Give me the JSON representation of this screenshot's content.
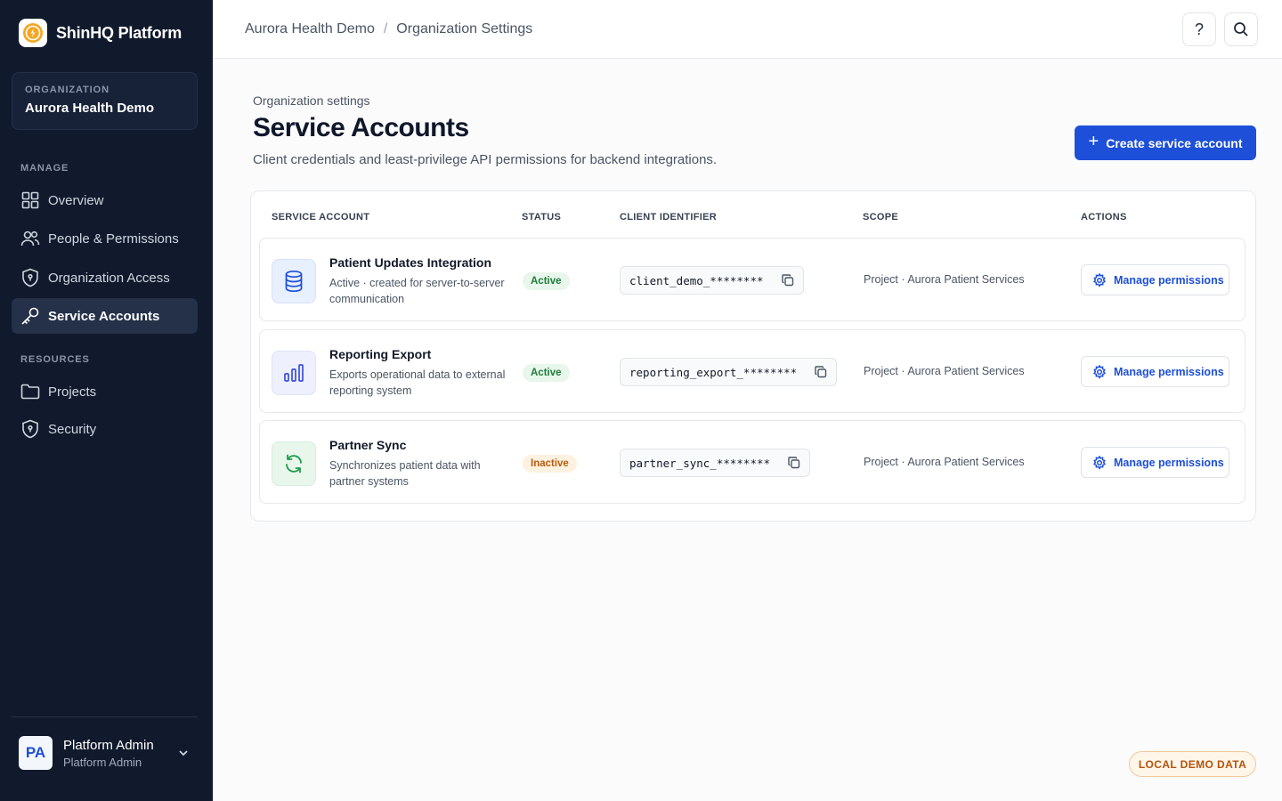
{
  "brand": {
    "name": "ShinHQ Platform",
    "logo_icon": "bolt-icon"
  },
  "organization": {
    "label": "ORGANIZATION",
    "name": "Aurora Health Demo"
  },
  "sidebar": {
    "manage_label": "MANAGE",
    "manage_items": [
      {
        "label": "Overview",
        "icon": "grid-icon"
      },
      {
        "label": "People & Permissions",
        "icon": "users-icon"
      },
      {
        "label": "Organization Access",
        "icon": "shield-icon"
      },
      {
        "label": "Service Accounts",
        "icon": "key-icon",
        "active": true
      }
    ],
    "resources_label": "RESOURCES",
    "resource_items": [
      {
        "label": "Projects",
        "icon": "folder-icon"
      },
      {
        "label": "Security",
        "icon": "shield-icon"
      }
    ]
  },
  "user": {
    "initials": "PA",
    "name": "Platform Admin",
    "role": "Platform Admin"
  },
  "topbar": {
    "breadcrumb": [
      "Aurora Health Demo",
      "Organization Settings"
    ],
    "separator": "/",
    "help_label": "?",
    "search_icon": "search-icon"
  },
  "page": {
    "kicker": "Organization settings",
    "title": "Service Accounts",
    "description": "Client credentials and least-privilege API permissions for backend integrations.",
    "create_plus": "+",
    "create_label": "Create service account"
  },
  "table": {
    "headers": [
      "SERVICE ACCOUNT",
      "STATUS",
      "CLIENT IDENTIFIER",
      "SCOPE",
      "ACTIONS"
    ],
    "rows": [
      {
        "name": "Patient Updates Integration",
        "description": "Active · created for server-to-server communication",
        "status": "Active",
        "client_id": "client_demo_********",
        "scope": "Project · Aurora Patient Services",
        "action": "Manage permissions",
        "icon": "database-icon"
      },
      {
        "name": "Reporting Export",
        "description": "Exports operational data to external reporting system",
        "status": "Active",
        "client_id": "reporting_export_********",
        "scope": "Project · Aurora Patient Services",
        "action": "Manage permissions",
        "icon": "bar-chart-icon"
      },
      {
        "name": "Partner Sync",
        "description": "Synchronizes patient data with partner systems",
        "status": "Inactive",
        "client_id": "partner_sync_********",
        "scope": "Project · Aurora Patient Services",
        "action": "Manage permissions",
        "icon": "refresh-icon"
      }
    ]
  },
  "demo_badge": "LOCAL DEMO DATA",
  "colors": {
    "sidebar_bg": "#111a2c",
    "primary": "#1d4fd8",
    "active_green": "#1e7d3a",
    "inactive_orange": "#b85c10"
  }
}
